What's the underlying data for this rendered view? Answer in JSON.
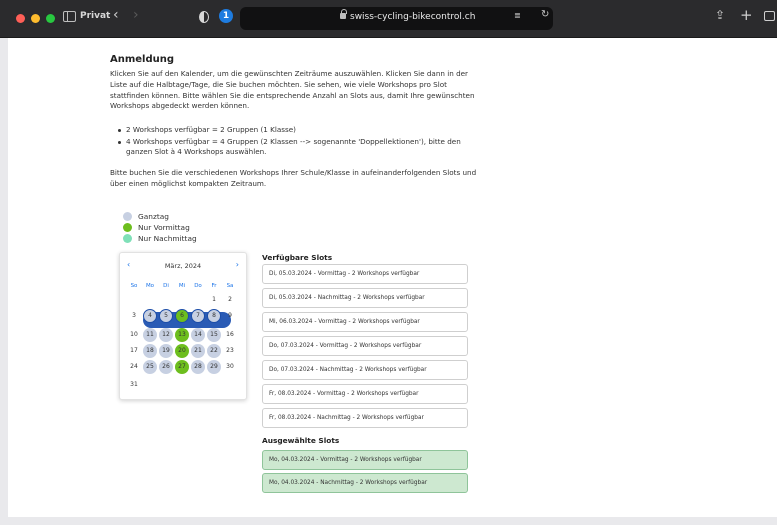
{
  "browser": {
    "tab_label": "Privat",
    "url": "swiss-cycling-bikecontrol.ch",
    "password_icon_letter": "⓪"
  },
  "content": {
    "heading": "Anmeldung",
    "intro": "Klicken Sie auf den Kalender, um die gewünschten Zeiträume auszuwählen. Klicken Sie dann in der Liste auf die Halbtage/Tage, die Sie buchen möchten. Sie sehen, wie viele Workshops pro Slot stattfinden können. Bitte wählen Sie die entsprechende Anzahl an Slots aus, damit Ihre gewünschten Workshops abgedeckt werden können.",
    "bullets": [
      "2 Workshops verfügbar = 2 Gruppen (1 Klasse)",
      "4 Workshops verfügbar = 4 Gruppen (2 Klassen --> sogenannte 'Doppellektionen'), bitte den ganzen Slot à 4 Workshops auswählen."
    ],
    "outro": "Bitte buchen Sie die verschiedenen Workshops Ihrer Schule/Klasse in aufeinanderfolgenden Slots und über einen möglichst kompakten Zeitraum."
  },
  "legend": [
    {
      "label": "Ganztag",
      "color": "#c7d0e2"
    },
    {
      "label": "Nur Vormittag",
      "color": "#6dbe1e"
    },
    {
      "label": "Nur Nachmittag",
      "color": "#7fe0b8"
    }
  ],
  "calendar": {
    "month_label": "März, 2024",
    "prev_symbol": "‹",
    "next_symbol": "›",
    "weekdays": [
      "So",
      "Mo",
      "Di",
      "Mi",
      "Do",
      "Fr",
      "Sa"
    ],
    "weeks": [
      [
        null,
        null,
        null,
        null,
        null,
        {
          "d": "1"
        },
        {
          "d": "2"
        }
      ],
      [
        {
          "d": "3"
        },
        {
          "d": "4",
          "s": "sel-full"
        },
        {
          "d": "5",
          "s": "sel-full"
        },
        {
          "d": "6",
          "s": "sel-morning"
        },
        {
          "d": "7",
          "s": "sel-full"
        },
        {
          "d": "8",
          "s": "sel-full"
        },
        {
          "d": "9"
        }
      ],
      [
        {
          "d": "10"
        },
        {
          "d": "11",
          "s": "full"
        },
        {
          "d": "12",
          "s": "full"
        },
        {
          "d": "13",
          "s": "morning"
        },
        {
          "d": "14",
          "s": "full"
        },
        {
          "d": "15",
          "s": "full"
        },
        {
          "d": "16"
        }
      ],
      [
        {
          "d": "17"
        },
        {
          "d": "18",
          "s": "full"
        },
        {
          "d": "19",
          "s": "full"
        },
        {
          "d": "20",
          "s": "morning"
        },
        {
          "d": "21",
          "s": "full"
        },
        {
          "d": "22",
          "s": "full"
        },
        {
          "d": "23"
        }
      ],
      [
        {
          "d": "24"
        },
        {
          "d": "25",
          "s": "full"
        },
        {
          "d": "26",
          "s": "full"
        },
        {
          "d": "27",
          "s": "morning"
        },
        {
          "d": "28",
          "s": "full"
        },
        {
          "d": "29",
          "s": "full"
        },
        {
          "d": "30"
        }
      ],
      [
        {
          "d": "31"
        },
        null,
        null,
        null,
        null,
        null,
        null
      ]
    ]
  },
  "slots": {
    "available_title": "Verfügbare Slots",
    "available": [
      "Di, 05.03.2024 - Vormittag - 2 Workshops verfügbar",
      "Di, 05.03.2024 - Nachmittag - 2 Workshops verfügbar",
      "Mi, 06.03.2024 - Vormittag - 2 Workshops verfügbar",
      "Do, 07.03.2024 - Vormittag - 2 Workshops verfügbar",
      "Do, 07.03.2024 - Nachmittag - 2 Workshops verfügbar",
      "Fr, 08.03.2024 - Vormittag - 2 Workshops verfügbar",
      "Fr, 08.03.2024 - Nachmittag - 2 Workshops verfügbar"
    ],
    "selected_title": "Ausgewählte Slots",
    "selected": [
      "Mo, 04.03.2024 - Vormittag - 2 Workshops verfügbar",
      "Mo, 04.03.2024 - Nachmittag - 2 Workshops verfügbar"
    ]
  }
}
